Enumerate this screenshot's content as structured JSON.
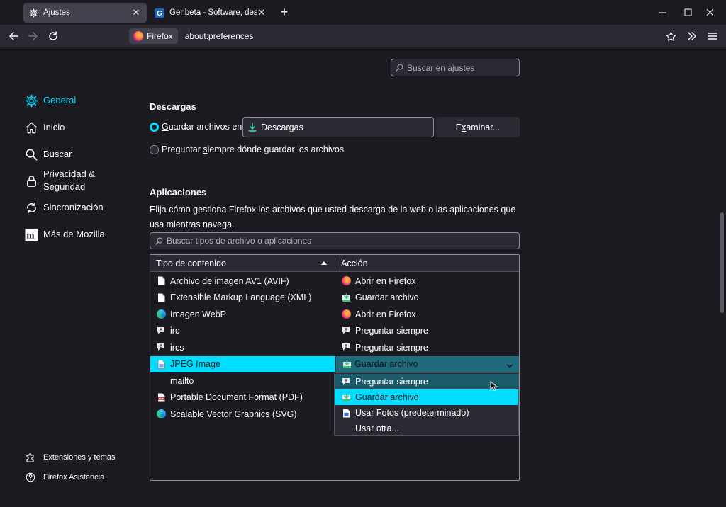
{
  "tabs": [
    {
      "title": "Ajustes",
      "active": true,
      "icon": "gear-icon"
    },
    {
      "title": "Genbeta - Software, descargas, ",
      "active": false,
      "icon": "genbeta-logo-icon"
    }
  ],
  "newtab_label": "+",
  "navbar": {
    "identity_label": "Firefox",
    "url": "about:preferences"
  },
  "search_settings": {
    "placeholder": "Buscar en ajustes"
  },
  "sidebar": {
    "items": [
      {
        "label": "General",
        "icon": "gear-icon",
        "selected": true
      },
      {
        "label": "Inicio",
        "icon": "home-icon"
      },
      {
        "label": "Buscar",
        "icon": "search-icon"
      },
      {
        "label_line1": "Privacidad &",
        "label_line2": "Seguridad",
        "icon": "lock-icon"
      },
      {
        "label": "Sincronización",
        "icon": "sync-icon"
      },
      {
        "label": "Más de Mozilla",
        "icon": "mozilla-icon"
      }
    ],
    "footer": [
      {
        "label": "Extensiones y temas",
        "icon": "puzzle-icon"
      },
      {
        "label": "Firefox Asistencia",
        "icon": "help-icon"
      }
    ]
  },
  "downloads": {
    "heading": "Descargas",
    "save_prefix": "G",
    "save_rest": "uardar archivos en",
    "folder": "Descargas",
    "browse_pre": "E",
    "browse_u": "x",
    "browse_rest": "aminar...",
    "ask_pre": "Preguntar ",
    "ask_u": "s",
    "ask_rest": "iempre dónde guardar los archivos"
  },
  "applications": {
    "heading": "Aplicaciones",
    "description": "Elija cómo gestiona Firefox los archivos que usted descarga de la web o las aplicaciones que usa mientras navega.",
    "filter_placeholder": "Buscar tipos de archivo o aplicaciones",
    "col_type": "Tipo de contenido",
    "col_action": "Acción",
    "rows": [
      {
        "type": "Archivo de imagen AV1 (AVIF)",
        "type_icon": "file-icon",
        "action": "Abrir en Firefox",
        "action_icon": "firefox-icon"
      },
      {
        "type": "Extensible Markup Language (XML)",
        "type_icon": "file-icon",
        "action": "Guardar archivo",
        "action_icon": "save-file-icon"
      },
      {
        "type": "Imagen WebP",
        "type_icon": "edge-icon",
        "action": "Abrir en Firefox",
        "action_icon": "firefox-icon"
      },
      {
        "type": "irc",
        "type_icon": "chat-icon",
        "action": "Preguntar siempre",
        "action_icon": "ask-icon"
      },
      {
        "type": "ircs",
        "type_icon": "chat-icon",
        "action": "Preguntar siempre",
        "action_icon": "ask-icon"
      },
      {
        "type": "JPEG Image",
        "type_icon": "image-file-icon",
        "action": "Guardar archivo",
        "action_icon": "save-file-icon",
        "selected": true
      },
      {
        "type": "mailto",
        "type_icon": "",
        "action": "",
        "action_icon": ""
      },
      {
        "type": "Portable Document Format (PDF)",
        "type_icon": "pdf-icon",
        "action": "",
        "action_icon": ""
      },
      {
        "type": "Scalable Vector Graphics (SVG)",
        "type_icon": "edge-icon",
        "action": "",
        "action_icon": ""
      }
    ],
    "dropdown_options": [
      {
        "label": "Preguntar siempre",
        "icon": "ask-icon",
        "state": "hover"
      },
      {
        "label": "Guardar archivo",
        "icon": "save-file-icon",
        "state": "selected"
      },
      {
        "label": "Usar Fotos (predeterminado)",
        "icon": "photos-icon",
        "state": ""
      },
      {
        "label": "Usar otra...",
        "icon": "",
        "state": ""
      }
    ]
  },
  "colors": {
    "accent": "#00ddff",
    "background": "#1c1b22",
    "surface": "#2b2a33"
  }
}
